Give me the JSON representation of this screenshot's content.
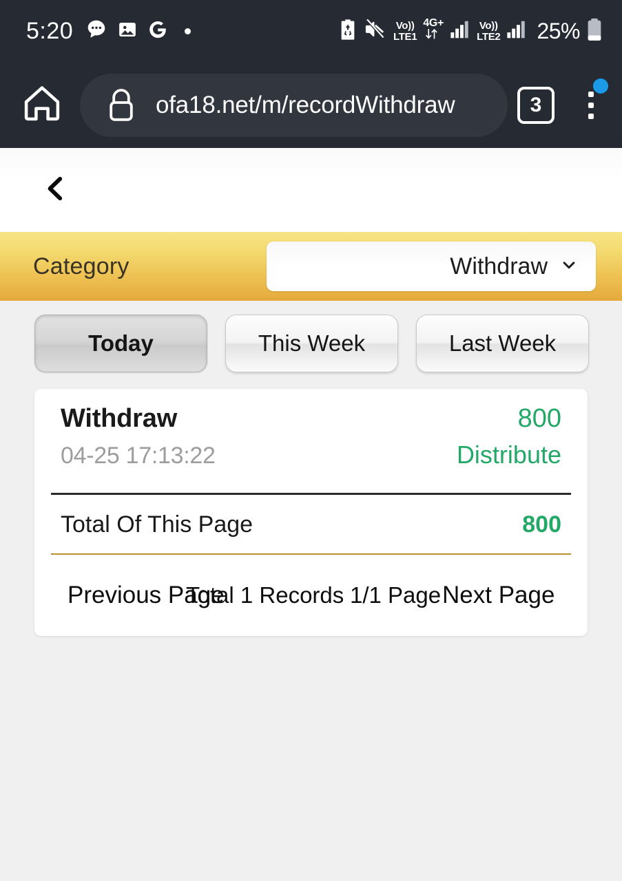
{
  "status_bar": {
    "time": "5:20",
    "left_icons": [
      "message-bubble-icon",
      "photo-icon",
      "google-g-icon",
      "dot-indicator-icon"
    ],
    "right_icons": [
      "battery-saver-icon",
      "mute-icon"
    ],
    "sim1_voice": "Vo))",
    "sim1_label": "LTE1",
    "network_gen": "4G+",
    "sim2_voice": "Vo))",
    "sim2_label": "LTE2",
    "battery_percent": "25%"
  },
  "browser": {
    "home_icon": "home-icon",
    "lock_icon": "lock-icon",
    "url": "ofa18.net/m/recordWithdraw",
    "tab_count": "3",
    "menu_icon": "overflow-menu-icon"
  },
  "nav": {
    "back_icon": "chevron-left-icon"
  },
  "category": {
    "label": "Category",
    "selected": "Withdraw",
    "chevron_icon": "chevron-down-icon"
  },
  "tabs": [
    {
      "label": "Today",
      "active": true
    },
    {
      "label": "This Week",
      "active": false
    },
    {
      "label": "Last Week",
      "active": false
    }
  ],
  "records": [
    {
      "title": "Withdraw",
      "date": "04-25 17:13:22",
      "amount": "800",
      "status": "Distribute"
    }
  ],
  "totals": {
    "label": "Total Of This Page",
    "value": "800"
  },
  "pagination": {
    "previous": "Previous Page",
    "total_records": "Total 1 Records",
    "page_indicator": "1/1 Page",
    "next": "Next Page"
  },
  "colors": {
    "accent_gold": "#e5a93c",
    "accent_gold_light": "#f7e486",
    "green": "#23a868",
    "chrome_dark": "#262a33",
    "page_bg": "#f0f0f0",
    "notification_blue": "#1b9ae8"
  }
}
